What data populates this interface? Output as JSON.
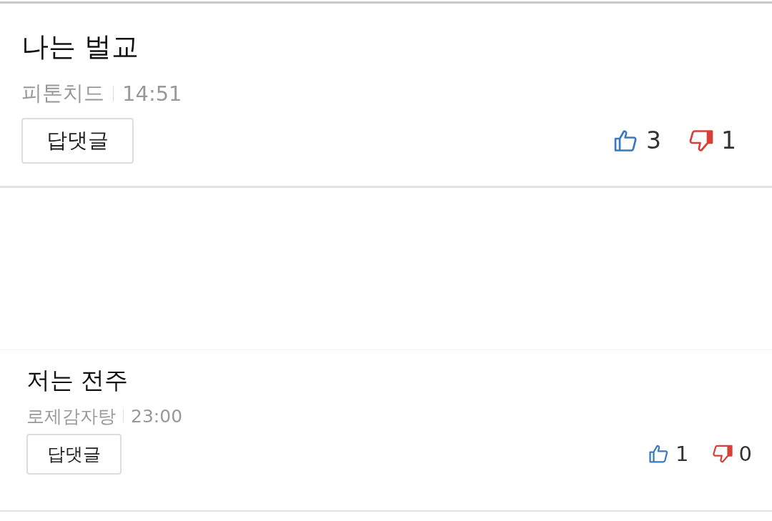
{
  "comments": [
    {
      "text": "나는 벌교",
      "author": "피톤치드",
      "time": "14:51",
      "reply_button": "답댓글",
      "likes": "3",
      "dislikes": "1"
    },
    {
      "text": "저는 전주",
      "author": "로제감자탕",
      "time": "23:00",
      "reply_button": "답댓글",
      "likes": "1",
      "dislikes": "0"
    }
  ]
}
